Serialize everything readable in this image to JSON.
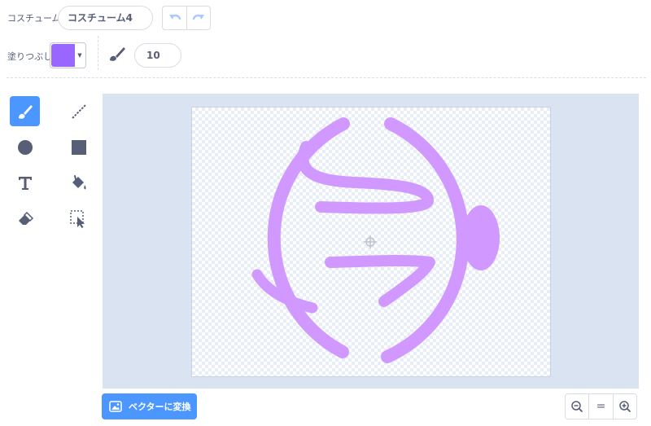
{
  "costume": {
    "label": "コスチューム",
    "name": "コスチューム4"
  },
  "fill": {
    "label": "塗りつぶし",
    "color": "#9966ff"
  },
  "brush": {
    "size": "10"
  },
  "convert_button": {
    "label": "ベクターに変換"
  },
  "zoom": {
    "reset_label": "="
  },
  "drawing_color": "#d199ff",
  "accent_color": "#4c97ff",
  "tools": [
    "brush-icon",
    "line-icon",
    "circle-icon",
    "rectangle-icon",
    "text-icon",
    "fill-bucket-icon",
    "eraser-icon",
    "select-icon"
  ]
}
